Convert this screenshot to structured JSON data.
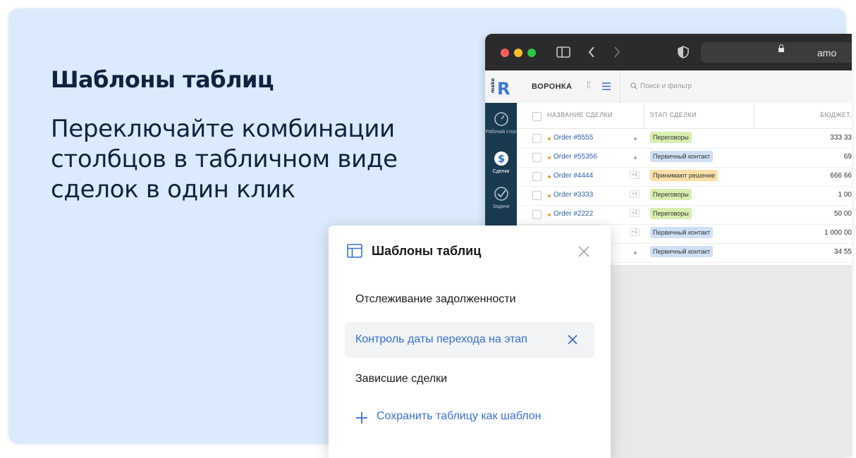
{
  "promo": {
    "heading": "Шаблоны таблиц",
    "subtitle": "Переключайте комбинации столбцов в табличном виде сделок в один клик"
  },
  "browser": {
    "url_partial": "amo"
  },
  "crm": {
    "logo_text": "make",
    "funnel_label": "ВОРОНКА",
    "search_placeholder": "Поиск и фильтр",
    "sidebar": [
      {
        "label": "Рабочий стол",
        "icon": "dashboard-icon"
      },
      {
        "label": "Сделки",
        "icon": "deals-dollar-icon"
      },
      {
        "label": "Задачи",
        "icon": "tasks-check-icon"
      }
    ],
    "columns": [
      "НАЗВАНИЕ СДЕЛКИ",
      "ЭТАП СДЕЛКИ",
      "БЮДЖЕТ,"
    ],
    "rows": [
      {
        "name": "Order #5555",
        "marker": "•",
        "stage": "Переговоры",
        "stage_color": "#d8efb0",
        "budget": "333 33"
      },
      {
        "name": "Order #55356",
        "marker": "•",
        "stage": "Первичный контакт",
        "stage_color": "#cfe0f5",
        "budget": "69"
      },
      {
        "name": "Order #4444",
        "marker": "+1",
        "stage": "Принимают решение",
        "stage_color": "#fbe0a8",
        "budget": "666 66"
      },
      {
        "name": "Order #3333",
        "marker": "+1",
        "stage": "Переговоры",
        "stage_color": "#d8efb0",
        "budget": "1 00"
      },
      {
        "name": "Order #2222",
        "marker": "+1",
        "stage": "Переговоры",
        "stage_color": "#d8efb0",
        "budget": "50 00"
      },
      {
        "name": "",
        "marker": "+1",
        "stage": "Первичный контакт",
        "stage_color": "#cfe0f5",
        "budget": "1 000 00"
      },
      {
        "name": "",
        "marker": "•",
        "stage": "Первичный контакт",
        "stage_color": "#cfe0f5",
        "budget": "34 55"
      }
    ]
  },
  "popup": {
    "title": "Шаблоны таблиц",
    "items": [
      {
        "label": "Отслеживание задолженности",
        "active": false
      },
      {
        "label": "Контроль даты перехода на этап",
        "active": true
      },
      {
        "label": "Зависшие сделки",
        "active": false
      }
    ],
    "save_label": "Сохранить таблицу как шаблон"
  },
  "colors": {
    "background": "#dbeafc",
    "accent": "#3a6dd8",
    "heading": "#0e2340",
    "sidebar": "#1a3a50"
  }
}
